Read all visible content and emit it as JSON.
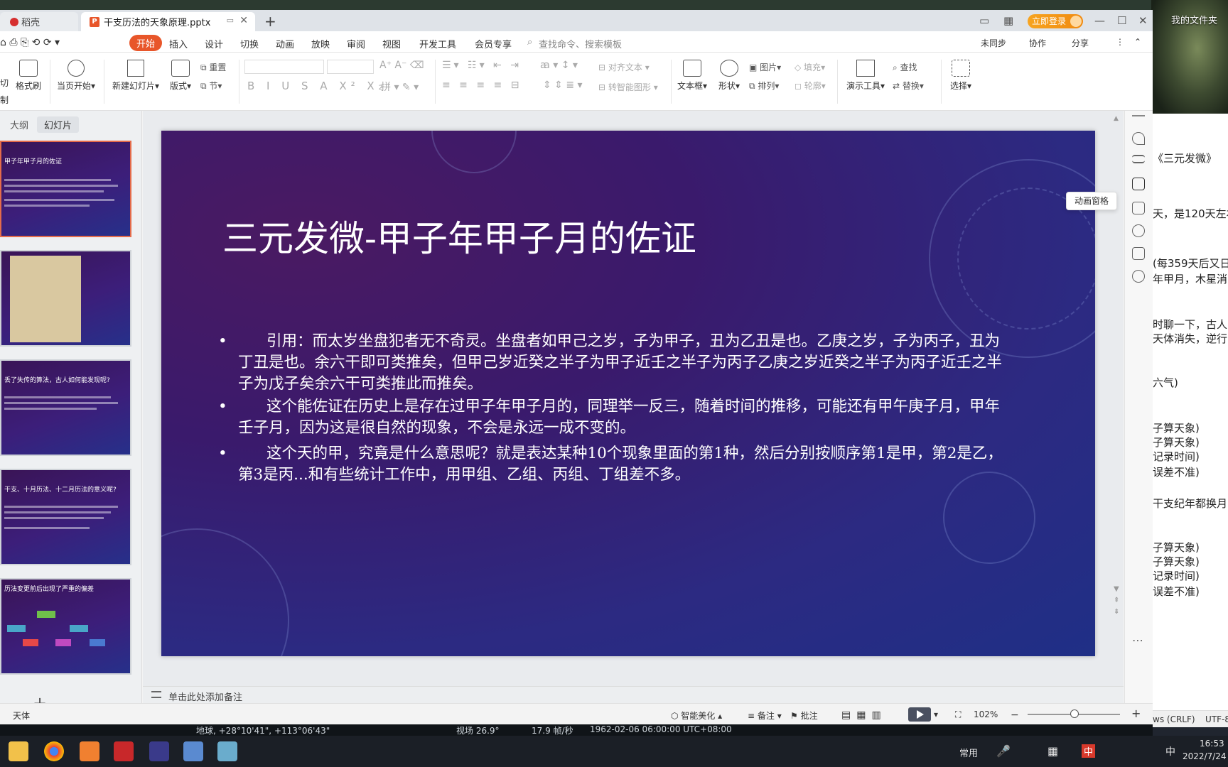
{
  "desktop": {
    "folder_label": "我的文件夹"
  },
  "tabs": {
    "home_tab": "稻壳",
    "file_tab": "干支历法的天象原理.pptx",
    "new_tab": "+"
  },
  "window": {
    "login_label": "立即登录"
  },
  "menu": {
    "items": [
      "开始",
      "插入",
      "设计",
      "切换",
      "动画",
      "放映",
      "审阅",
      "视图",
      "开发工具",
      "会员专享"
    ],
    "search_placeholder": "查找命令、搜索模板",
    "right": [
      "未同步",
      "协作",
      "分享"
    ]
  },
  "ribbon": {
    "cut": "切",
    "format_painter": "格式刷",
    "brush_left": "制",
    "from_current": "当页开始",
    "new_slide": "新建幻灯片",
    "layout": "版式",
    "reset": "重置",
    "section": "节",
    "align_text": "对齐文本",
    "smart_shape": "转智能图形",
    "textbox": "文本框",
    "shape": "形状",
    "picture": "图片",
    "arrange": "排列",
    "fill": "填充",
    "outline": "轮廓",
    "present_tools": "演示工具",
    "find": "查找",
    "replace": "替换",
    "select": "选择"
  },
  "left_panel": {
    "outline_tab": "大纲",
    "slides_tab": "幻灯片",
    "thumbs": [
      {
        "title": "甲子年甲子月的佐证"
      },
      {
        "title": ""
      },
      {
        "title": "丢了失传的算法，古人如何能发现呢?"
      },
      {
        "title": "干支、十月历法、十二月历法的意义呢?"
      },
      {
        "title": "历法变更前后出现了严重的偏差"
      }
    ],
    "add_slide": "+"
  },
  "slide": {
    "title": "三元发微-甲子年甲子月的佐证",
    "bullets": [
      "引用：而太岁坐盘犯者无不奇灵。坐盘者如甲己之岁，子为甲子，丑为乙丑是也。乙庚之岁，子为丙子，丑为丁丑是也。余六干即可类推矣，但甲己岁近癸之半子为甲子近壬之半子为丙子乙庚之岁近癸之半子为丙子近壬之半子为戊子矣余六干可类推此而推矣。",
      "这个能佐证在历史上是存在过甲子年甲子月的，同理举一反三，随着时间的推移，可能还有甲午庚子月，甲年壬子月，因为这是很自然的现象，不会是永远一成不变的。",
      "这个天的甲，究竟是什么意思呢？就是表达某种10个现象里面的第1种，然后分别按顺序第1是甲，第2是乙，第3是丙...和有些统计工作中，用甲组、乙组、丙组、丁组差不多。"
    ],
    "bullet_glyph": "•"
  },
  "sidebar": {
    "tooltip": "动画窗格"
  },
  "notes": {
    "placeholder": "单击此处添加备注"
  },
  "statusbar": {
    "font": "天体",
    "beautify": "智能美化",
    "notes": "备注",
    "comment": "批注",
    "zoom": "102%"
  },
  "doc_panel": {
    "lines": [
      "《三元发微》",
      "天，是120天左右",
      "(每359天后又日",
      "年甲月，木星消",
      "时聊一下，古人",
      "天体消失，逆行",
      "六气)",
      "子算天象)",
      "子算天象)",
      "记录时间)",
      "误差不准)",
      "干支纪年都换月",
      "子算天象)",
      "子算天象)",
      "记录时间)",
      "误差不准)"
    ],
    "status": [
      "ws (CRLF)",
      "UTF-8"
    ]
  },
  "stellarium": {
    "coords": "地球, +28°10'41\", +113°06'43\"",
    "fov": "视场 26.9°",
    "fps": "17.9 帧/秒",
    "datetime": "1962-02-06 06:00:00 UTC+08:00"
  },
  "taskbar": {
    "tray_label": "常用",
    "ime": "中",
    "time": "16:53",
    "date": "2022/7/24"
  }
}
